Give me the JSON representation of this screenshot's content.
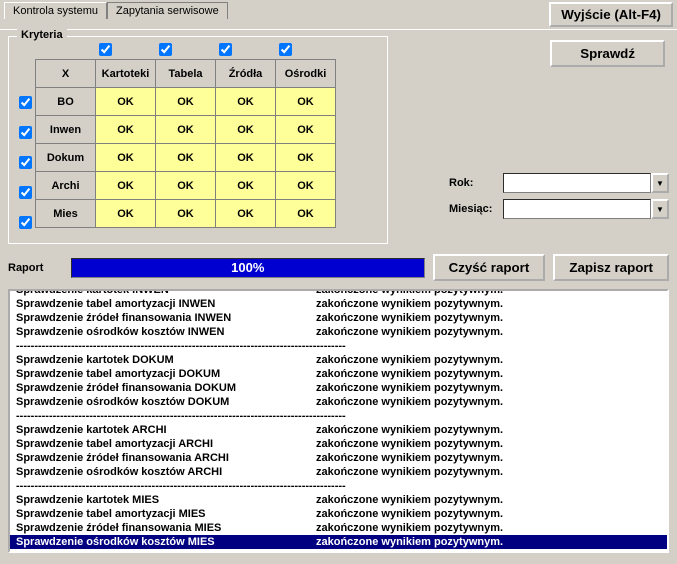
{
  "tabs": {
    "t1": "Kontrola systemu",
    "t2": "Zapytania serwisowe"
  },
  "exit": "Wyjście (Alt-F4)",
  "kryteria": {
    "legend": "Kryteria",
    "corner": "X",
    "cols": [
      "Kartoteki",
      "Tabela",
      "Źródła",
      "Ośrodki"
    ],
    "rows": [
      "BO",
      "Inwen",
      "Dokum",
      "Archi",
      "Mies"
    ],
    "cell": "OK"
  },
  "sprawdz": "Sprawdź",
  "rok_label": "Rok:",
  "miesiac_label": "Miesiąc:",
  "rok_value": "",
  "miesiac_value": "",
  "raport_label": "Raport",
  "progress": "100%",
  "clear_btn": "Czyść raport",
  "save_btn": "Zapisz raport",
  "sep": "------------------------------------------------------------------------------------------",
  "result_text": "zakończone wynikiem pozytywnym.",
  "report_groups": [
    [
      "Sprawdzenie kartotek INWEN",
      "Sprawdzenie tabel amortyzacji INWEN",
      "Sprawdzenie źródeł finansowania INWEN",
      "Sprawdzenie ośrodków kosztów INWEN"
    ],
    [
      "Sprawdzenie kartotek DOKUM",
      "Sprawdzenie tabel amortyzacji DOKUM",
      "Sprawdzenie źródeł finansowania DOKUM",
      "Sprawdzenie ośrodków kosztów DOKUM"
    ],
    [
      "Sprawdzenie kartotek ARCHI",
      "Sprawdzenie tabel amortyzacji ARCHI",
      "Sprawdzenie źródeł finansowania ARCHI",
      "Sprawdzenie ośrodków kosztów ARCHI"
    ],
    [
      "Sprawdzenie kartotek MIES",
      "Sprawdzenie tabel amortyzacji MIES",
      "Sprawdzenie źródeł finansowania MIES",
      "Sprawdzenie ośrodków kosztów MIES"
    ]
  ],
  "selected_line": "Sprawdzenie ośrodków kosztów MIES"
}
